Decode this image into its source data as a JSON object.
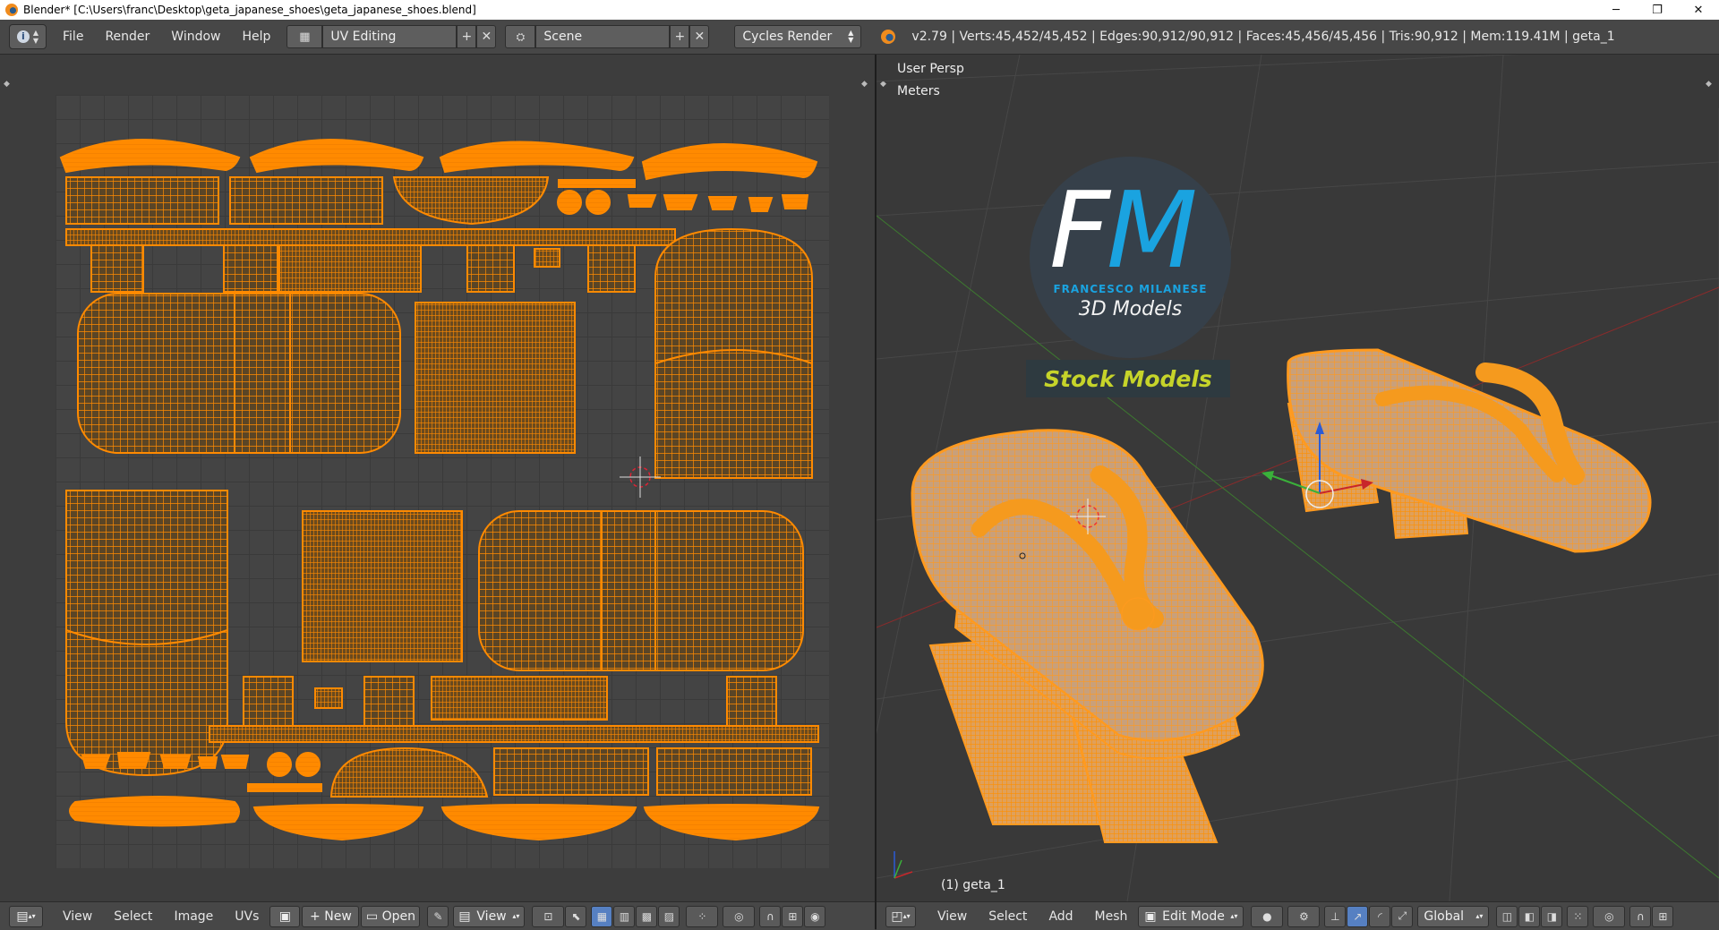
{
  "window": {
    "title": "Blender* [C:\\Users\\franc\\Desktop\\geta_japanese_shoes\\geta_japanese_shoes.blend]",
    "minimize": "─",
    "maximize": "❐",
    "close": "✕"
  },
  "info_header": {
    "editor_icon": "i",
    "menus": [
      "File",
      "Render",
      "Window",
      "Help"
    ],
    "screen_layout": "UV Editing",
    "scene": "Scene",
    "render_engine": "Cycles Render",
    "stats": "v2.79 | Verts:45,452/45,452 | Edges:90,912/90,912 | Faces:45,456/45,456 | Tris:90,912 | Mem:119.41M | geta_1"
  },
  "uv_editor": {
    "header_menus": [
      "View",
      "Select",
      "Image",
      "UVs"
    ],
    "new_label": "New",
    "open_label": "Open",
    "view_label": "View"
  },
  "viewport": {
    "view_name": "User Persp",
    "units": "Meters",
    "object_label": "(1) geta_1",
    "header_menus": [
      "View",
      "Select",
      "Add",
      "Mesh"
    ],
    "mode": "Edit Mode",
    "orientation": "Global"
  },
  "watermark": {
    "logo_letters_1": "F",
    "logo_letters_2": "M",
    "brand": "FRANCESCO MILANESE",
    "tagline": "3D Models",
    "badge": "Stock Models"
  },
  "colors": {
    "uv_orange": "#ff8a00",
    "mesh_orange": "#f59a1e",
    "active_blue": "#5680c2",
    "logo_blue": "#1aa3e0"
  }
}
